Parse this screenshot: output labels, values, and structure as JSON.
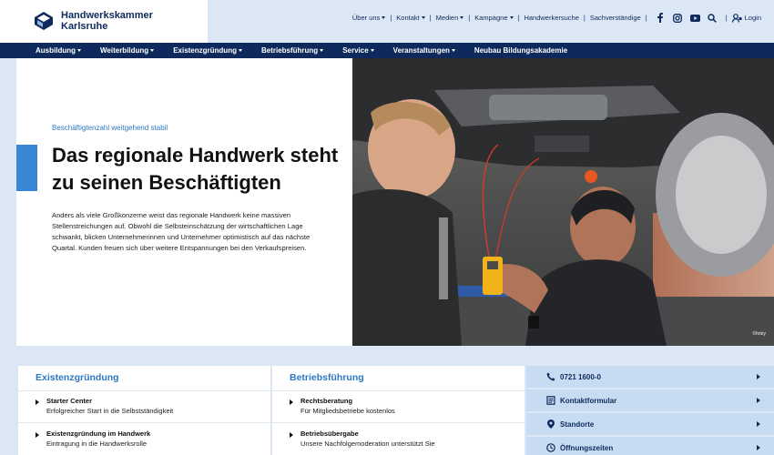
{
  "header": {
    "logo_line1": "Handwerkskammer",
    "logo_line2": "Karlsruhe",
    "util_nav": [
      {
        "label": "Über uns",
        "dropdown": true
      },
      {
        "label": "Kontakt",
        "dropdown": true
      },
      {
        "label": "Medien",
        "dropdown": true
      },
      {
        "label": "Kampagne",
        "dropdown": true
      },
      {
        "label": "Handwerkersuche",
        "dropdown": false
      },
      {
        "label": "Sachverständige",
        "dropdown": false
      }
    ],
    "social_icons": [
      "facebook-icon",
      "instagram-icon",
      "youtube-icon",
      "search-icon"
    ],
    "login_label": "Login"
  },
  "main_nav": [
    {
      "label": "Ausbildung",
      "dropdown": true
    },
    {
      "label": "Weiterbildung",
      "dropdown": true
    },
    {
      "label": "Existenzgründung",
      "dropdown": true
    },
    {
      "label": "Betriebsführung",
      "dropdown": true
    },
    {
      "label": "Service",
      "dropdown": true
    },
    {
      "label": "Veranstaltungen",
      "dropdown": true
    },
    {
      "label": "Neubau Bildungsakademie",
      "dropdown": false
    }
  ],
  "hero": {
    "kicker": "Beschäftigtenzahl weitgehend stabil",
    "title": "Das regionale Handwerk steht zu seinen Beschäftigten",
    "body": "Anders als viele Großkonzerne weist das regionale Handwerk keine massiven Stellenstreichungen auf. Obwohl die Selbsteinschätzung der wirtschaftlichen Lage schwankt, blicken Unternehmerinnen und Unternehmer optimistisch auf das nächste Quartal. Kunden freuen sich über weitere Entspannungen bei den Verkaufspreisen.",
    "image_credit": "©fotey"
  },
  "cards": [
    {
      "title": "Existenzgründung",
      "items": [
        {
          "title": "Starter Center",
          "subtitle": "Erfolgreicher Start in die Selbstständigkeit"
        },
        {
          "title": "Existenzgründung im Handwerk",
          "subtitle": "Eintragung in die Handwerksrolle"
        }
      ]
    },
    {
      "title": "Betriebsführung",
      "items": [
        {
          "title": "Rechtsberatung",
          "subtitle": "Für Mitgliedsbetriebe kostenlos"
        },
        {
          "title": "Betriebsübergabe",
          "subtitle": "Unsere Nachfolgemoderation unterstützt Sie"
        }
      ]
    }
  ],
  "contact": [
    {
      "label": "0721 1600-0",
      "icon": "phone-icon"
    },
    {
      "label": "Kontaktformular",
      "icon": "form-icon"
    },
    {
      "label": "Standorte",
      "icon": "location-pin-icon"
    },
    {
      "label": "Öffnungszeiten",
      "icon": "clock-icon"
    }
  ],
  "colors": {
    "navy": "#0e2a5c",
    "accent_blue": "#2b78c5",
    "light_blue": "#dbe7f5",
    "panel_blue": "#c7dcf3"
  }
}
